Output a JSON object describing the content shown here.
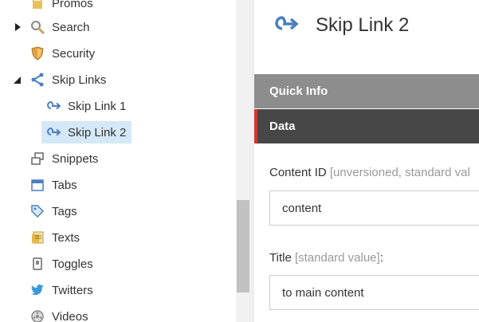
{
  "tree": {
    "items": [
      {
        "label": "Promos",
        "icon": "promo-icon"
      },
      {
        "label": "Search",
        "icon": "search-icon"
      },
      {
        "label": "Security",
        "icon": "shield-icon"
      },
      {
        "label": "Skip Links",
        "icon": "share-icon"
      },
      {
        "label": "Skip Link 1",
        "icon": "skip-link-icon"
      },
      {
        "label": "Skip Link 2",
        "icon": "skip-link-icon"
      },
      {
        "label": "Snippets",
        "icon": "snippets-icon"
      },
      {
        "label": "Tabs",
        "icon": "tabs-icon"
      },
      {
        "label": "Tags",
        "icon": "tag-icon"
      },
      {
        "label": "Texts",
        "icon": "texts-icon"
      },
      {
        "label": "Toggles",
        "icon": "toggle-icon"
      },
      {
        "label": "Twitters",
        "icon": "twitter-icon"
      },
      {
        "label": "Videos",
        "icon": "video-icon"
      }
    ],
    "selected": "Skip Link 2"
  },
  "page": {
    "title": "Skip Link 2",
    "icon": "skip-link-icon"
  },
  "sections": {
    "quick_info": "Quick Info",
    "data": "Data"
  },
  "fields": {
    "content_id": {
      "label": "Content ID",
      "hint": "[unversioned, standard val",
      "value": "content"
    },
    "title": {
      "label": "Title",
      "hint": "[standard value]",
      "suffix": ":",
      "value": "to main content"
    }
  },
  "colors": {
    "accent": "#4b7fbe",
    "selection": "#d4e8f7",
    "data_marker": "#d6322c"
  }
}
